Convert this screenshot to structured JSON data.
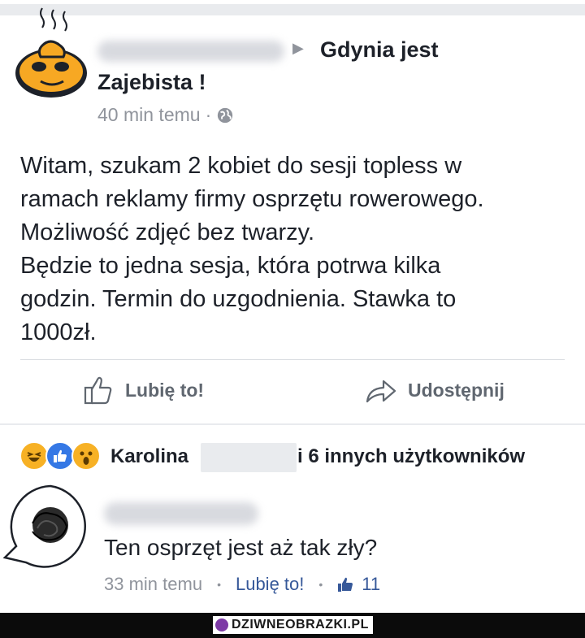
{
  "post": {
    "group_name_line1": "Gdynia jest",
    "group_name_line2": "Zajebista !",
    "timestamp": "40 min temu",
    "meta_dot": "·",
    "privacy_icon": "globe-icon",
    "body_lines": [
      "Witam, szukam 2 kobiet do sesji topless w",
      "ramach reklamy firmy osprzętu rowerowego.",
      "Możliwość zdjęć bez twarzy.",
      "Będzie to jedna sesja, która potrwa kilka",
      "godzin. Termin do uzgodnienia. Stawka to",
      "1000zł."
    ]
  },
  "actions": {
    "like_label": "Lubię to!",
    "share_label": "Udostępnij"
  },
  "reactions": {
    "icons": [
      "haha-icon",
      "like-icon",
      "wow-icon"
    ],
    "first_name": "Karolina",
    "rest_text": "i 6 innych użytkowników"
  },
  "comment": {
    "text": "Ten osprzęt jest aż tak zły?",
    "timestamp": "33 min temu",
    "like_link": "Lubię to!",
    "like_count": "11"
  },
  "watermark": {
    "text": "DZIWNEOBRAZKI.PL"
  },
  "colors": {
    "text": "#1d2129",
    "muted": "#90949c",
    "link": "#365899",
    "avatar_orange": "#f5a623"
  }
}
